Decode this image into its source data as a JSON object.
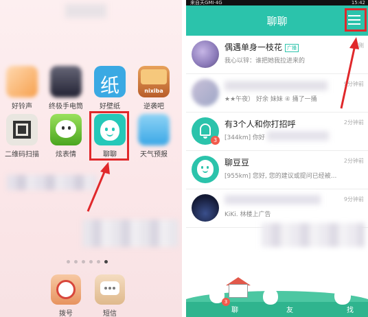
{
  "left_screen": {
    "apps": [
      {
        "label": "好铃声",
        "icon": "ringtone-icon"
      },
      {
        "label": "终极手电筒",
        "icon": "flashlight-icon"
      },
      {
        "label": "好壁纸",
        "icon": "wallpaper-icon",
        "glyph": "纸"
      },
      {
        "label": "逆袭吧",
        "icon": "nixiba-icon",
        "glyph": "nixiba"
      },
      {
        "label": "二维码扫描",
        "icon": "qrcode-icon"
      },
      {
        "label": "炫表情",
        "icon": "emoji-icon"
      },
      {
        "label": "聊聊",
        "icon": "chat-app-icon"
      },
      {
        "label": "天气预报",
        "icon": "weather-icon"
      }
    ],
    "dock": [
      {
        "label": "拨号",
        "icon": "dial-icon"
      },
      {
        "label": "短信",
        "icon": "sms-icon"
      }
    ],
    "page_indicator": {
      "count": 6,
      "active_index": 5
    }
  },
  "right_screen": {
    "status_time": "15:42",
    "status_carrier": "来自天GMI·4G",
    "title": "聊聊",
    "menu_icon": "hamburger-menu-icon",
    "conversations": [
      {
        "name": "偶遇单身一枝花",
        "tag": "广播",
        "preview": "我心以锌：谁把她我拉进来的",
        "time": "刚刚"
      },
      {
        "name": "",
        "tag": "",
        "preview": "★★午夜） 好余 妹妹 ④ 捅了一捅",
        "time": "9分钟前"
      },
      {
        "name": "有3个人和你打招呼",
        "tag": "",
        "preview": "[344km] 你好",
        "time": "2分钟前",
        "badge": "3"
      },
      {
        "name": "聊豆豆",
        "tag": "",
        "preview": "[955km] 您好, 您的建议或提问已经被...",
        "time": "2分钟前"
      },
      {
        "name": "",
        "tag": "",
        "preview": "KiKi. 林楼上广告",
        "time": "9分钟前"
      }
    ],
    "bottom_tabs": [
      {
        "label": "聊",
        "badge": "3"
      },
      {
        "label": "友"
      },
      {
        "label": "找"
      }
    ]
  },
  "colors": {
    "accent": "#2bc3ab",
    "highlight": "#e0282b"
  }
}
